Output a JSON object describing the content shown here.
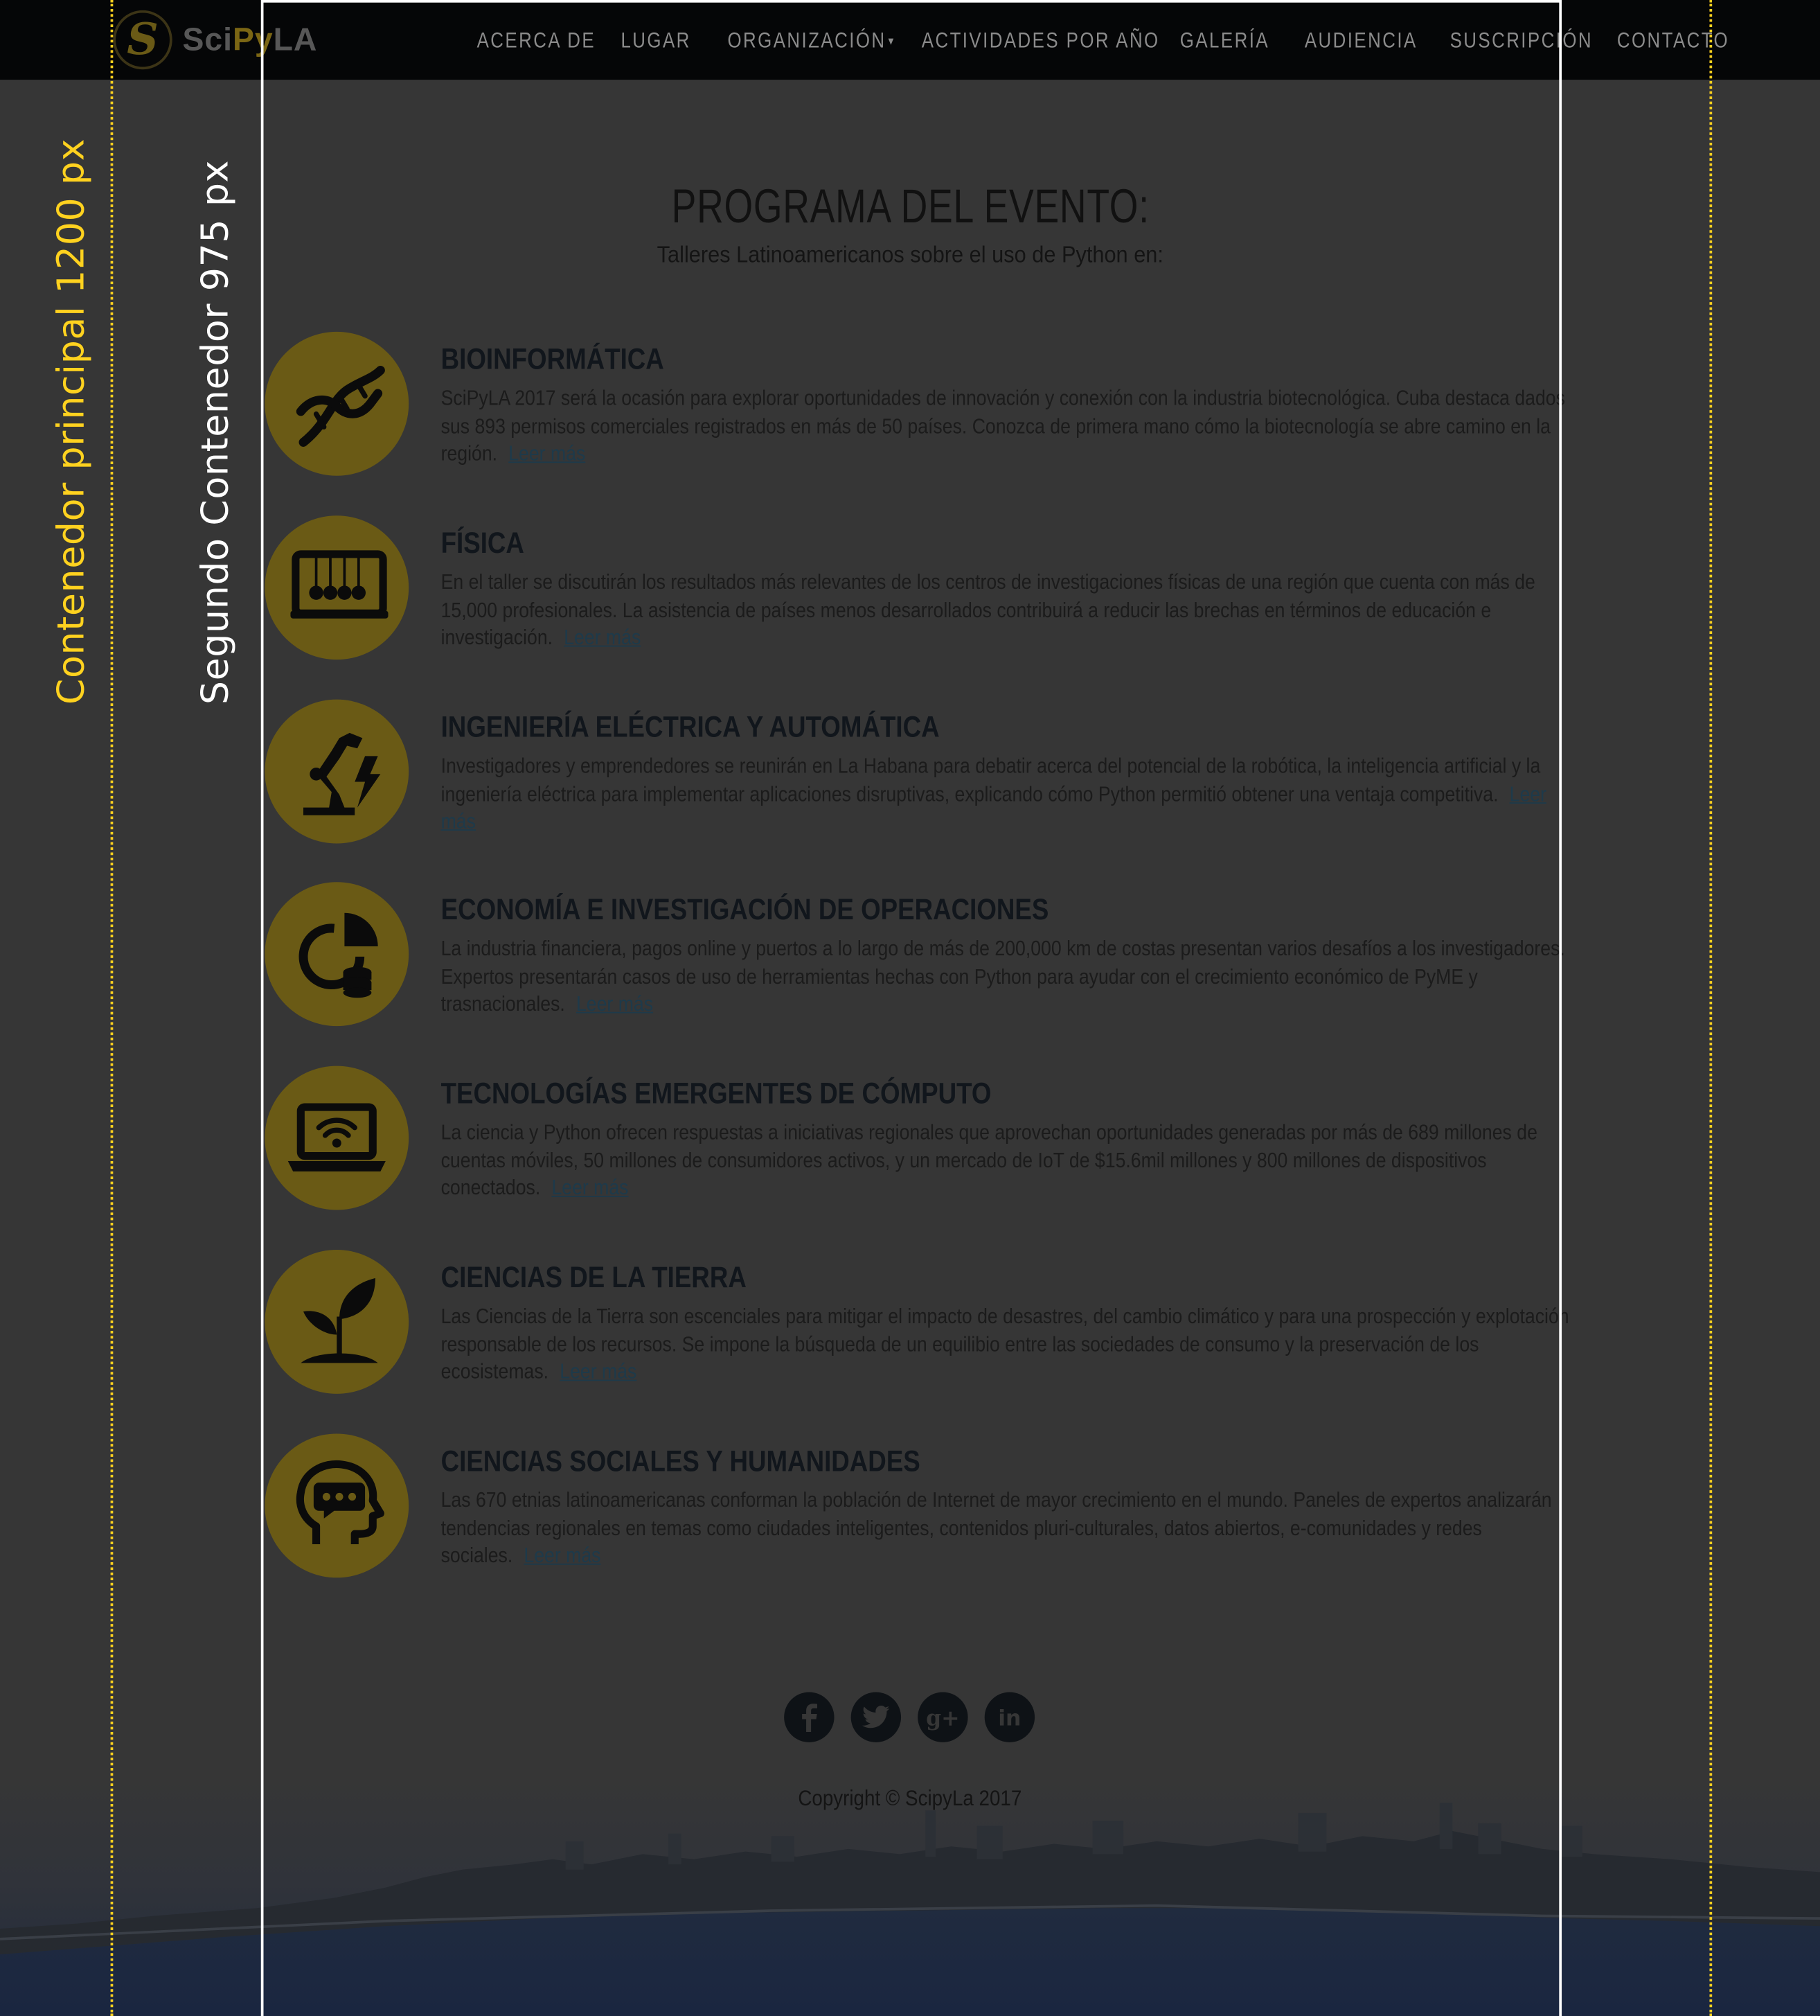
{
  "navbar": {
    "logo": {
      "sci": "Sci",
      "py": "Py",
      "la": "LA"
    },
    "items": [
      {
        "label": "ACERCA DE"
      },
      {
        "label": "LUGAR"
      },
      {
        "label": "ORGANIZACIÓN"
      },
      {
        "label": "ACTIVIDADES POR AÑO"
      },
      {
        "label": "GALERÍA"
      },
      {
        "label": "AUDIENCIA"
      },
      {
        "label": "SUSCRIPCIÓN"
      },
      {
        "label": "CONTACTO"
      }
    ],
    "dropdown_item_index": 2
  },
  "guides": {
    "main_container_label": "Contenedor principal 1200 px",
    "second_container_label": "Segundo Contenedor  975 px",
    "main_color": "#ffd21f",
    "second_color": "#ffffff"
  },
  "program": {
    "title": "PROGRAMA DEL EVENTO:",
    "subtitle": "Talleres Latinoamericanos sobre el uso de Python en:",
    "read_more": "Leer más",
    "workshops": [
      {
        "title": "BIOINFORMÁTICA",
        "icon": "dna-icon",
        "description": "SciPyLA 2017 será la ocasión para explorar oportunidades de innovación y conexión con la industria biotecnológica. Cuba destaca dados sus 893 permisos comerciales registrados en más de 50 países. Conozca de primera mano cómo la biotecnología se abre camino en la región."
      },
      {
        "title": "FÍSICA",
        "icon": "newtons-cradle-icon",
        "description": "En el taller se discutirán los resultados más relevantes de los centros de investigaciones físicas de una región que cuenta con más de 15,000 profesionales. La asistencia de países menos desarrollados contribuirá a reducir las brechas en términos de educación e investigación."
      },
      {
        "title": "INGENIERÍA ELÉCTRICA Y AUTOMÁTICA",
        "icon": "robot-arm-lightning-icon",
        "description": "Investigadores y emprendedores se reunirán en La Habana para debatir acerca del potencial de la robótica, la inteligencia artificial y la ingeniería eléctrica para implementar aplicaciones disruptivas, explicando cómo Python permitió obtener una ventaja competitiva."
      },
      {
        "title": "ECONOMÍA E INVESTIGACIÓN DE OPERACIONES",
        "icon": "pie-chart-coins-icon",
        "description": "La industria financiera, pagos online y puertos a lo largo de más de 200,000 km de costas presentan varios desafíos a los investigadores. Expertos presentarán casos de uso de herramientas hechas con Python para ayudar con el crecimiento económico de PyME y trasnacionales."
      },
      {
        "title": "TECNOLOGÍAS EMERGENTES DE CÓMPUTO",
        "icon": "laptop-wifi-icon",
        "description": "La ciencia y Python ofrecen respuestas a iniciativas regionales que aprovechan oportunidades generadas por más de 689 millones de cuentas móviles, 50 millones de consumidores activos, y un mercado de IoT de $15.6mil millones y 800 millones de dispositivos conectados."
      },
      {
        "title": "CIENCIAS DE LA TIERRA",
        "icon": "sprout-icon",
        "description": "Las Ciencias de la Tierra son escenciales para mitigar el impacto de desastres, del cambio climático y para una prospección y explotación responsable de los recursos. Se impone la búsqueda de un equilibio entre las sociedades de consumo y la preservación de los ecosistemas."
      },
      {
        "title": "CIENCIAS SOCIALES Y HUMANIDADES",
        "icon": "head-speech-icon",
        "description": "Las 670 etnias latinoamericanas conforman la población de Internet de mayor crecimiento en el mundo. Paneles de expertos analizarán tendencias regionales en temas como ciudades inteligentes, contenidos pluri-culturales, datos abiertos, e-comunidades y redes sociales."
      }
    ]
  },
  "footer": {
    "social": [
      {
        "name": "facebook-icon",
        "glyph": "f"
      },
      {
        "name": "twitter-icon",
        "glyph": ""
      },
      {
        "name": "google-plus-icon",
        "glyph": "g+"
      },
      {
        "name": "linkedin-icon",
        "glyph": "in"
      }
    ],
    "copyright": "Copyright © ScipyLa 2017"
  },
  "colors": {
    "background": "#363636",
    "navbar": "#050607",
    "icon_circle": "#6a5a15",
    "link": "#1e3a4a"
  }
}
